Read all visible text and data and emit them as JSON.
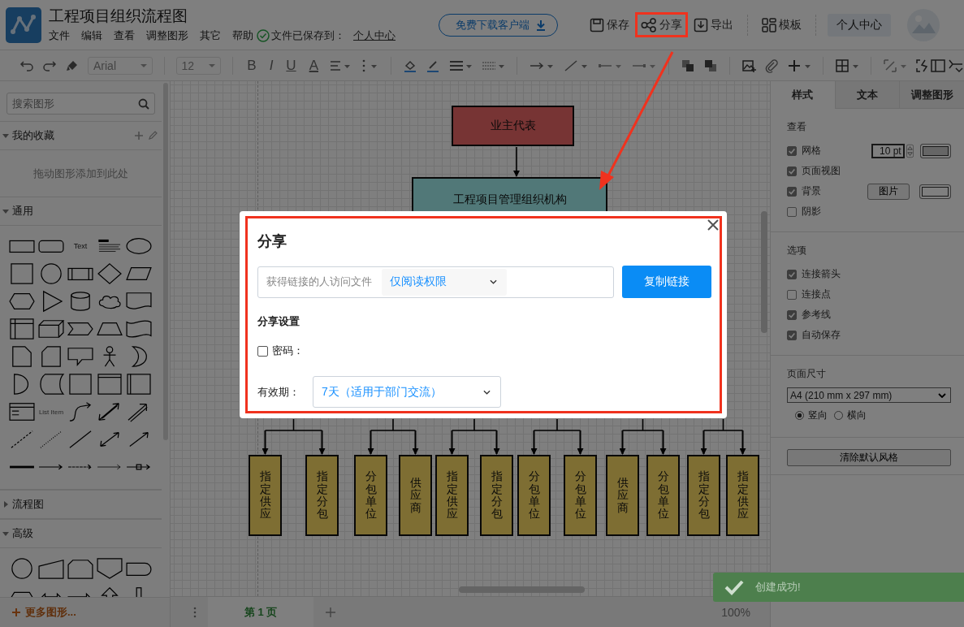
{
  "app": {
    "title": "工程项目组织流程图",
    "menu": [
      "文件",
      "编辑",
      "查看",
      "调整图形",
      "其它",
      "帮助"
    ],
    "save_status": "文件已保存到：",
    "save_location": "个人中心",
    "download_button": "免费下载客户端",
    "actions": [
      {
        "label": "保存",
        "kind": "save",
        "annotated": false
      },
      {
        "label": "分享",
        "kind": "share",
        "annotated": true
      },
      {
        "label": "导出",
        "kind": "export",
        "annotated": false
      },
      {
        "label": "模板",
        "kind": "template",
        "annotated": false
      }
    ],
    "user_button": "个人中心"
  },
  "toolbar": {
    "font": "Arial",
    "font_size": "12",
    "format_buttons": [
      "B",
      "I",
      "U",
      "A"
    ]
  },
  "sidebar": {
    "search": {
      "placeholder": "搜索图形"
    },
    "sections": [
      {
        "title": "我的收藏",
        "expanded": true,
        "kind": "favorites",
        "hint": "拖动图形添加到此处"
      },
      {
        "title": "通用",
        "expanded": true,
        "kind": "general",
        "shape_labels": [
          "Text",
          "List Item"
        ]
      },
      {
        "title": "流程图",
        "expanded": false,
        "kind": "collapsed"
      },
      {
        "title": "高级",
        "expanded": true,
        "kind": "advanced"
      }
    ],
    "more_button": "更多图形..."
  },
  "diagram": {
    "root": "业主代表",
    "organization": "工程项目管理组织机构",
    "units": [
      "指定供应",
      "指定分包",
      "分包单位",
      "供应商",
      "指定供应",
      "指定分包",
      "分包单位",
      "分包单位",
      "供应商",
      "分包单位",
      "指定分包",
      "指定供应"
    ]
  },
  "pages": {
    "tabs": [
      {
        "label": "第 1 页",
        "selected": true
      }
    ],
    "zoom": "100%"
  },
  "format_panel": {
    "tabs": [
      {
        "label": "样式",
        "selected": true
      },
      {
        "label": "文本",
        "selected": false
      },
      {
        "label": "调整图形",
        "selected": false
      }
    ],
    "sections": [
      {
        "title": "查看",
        "options": [
          {
            "label": "网格",
            "checked": true,
            "kind": "grid",
            "value": "10 pt"
          },
          {
            "label": "页面视图",
            "checked": true,
            "kind": "plain"
          },
          {
            "label": "背景",
            "checked": true,
            "kind": "background",
            "button": "图片"
          },
          {
            "label": "阴影",
            "checked": false,
            "kind": "plain"
          }
        ]
      },
      {
        "title": "选项",
        "options": [
          {
            "label": "连接箭头",
            "checked": true,
            "kind": "plain"
          },
          {
            "label": "连接点",
            "checked": false,
            "kind": "plain"
          },
          {
            "label": "参考线",
            "checked": true,
            "kind": "plain"
          },
          {
            "label": "自动保存",
            "checked": true,
            "kind": "plain"
          }
        ]
      }
    ],
    "page_size": {
      "title": "页面尺寸",
      "value": "A4 (210 mm x 297 mm)",
      "orientations": [
        {
          "label": "竖向",
          "selected": true
        },
        {
          "label": "横向",
          "selected": false
        }
      ]
    },
    "reset_button": "清除默认风格"
  },
  "share_dialog": {
    "title": "分享",
    "access_label": "获得链接的人访问文件",
    "permission": "仅阅读权限",
    "copy_button": "复制链接",
    "settings_title": "分享设置",
    "password": {
      "label": "密码：",
      "checked": false
    },
    "validity": {
      "label": "有效期：",
      "value": "7天（适用于部门交流）"
    },
    "annotated": true
  },
  "toast": "创建成功!"
}
